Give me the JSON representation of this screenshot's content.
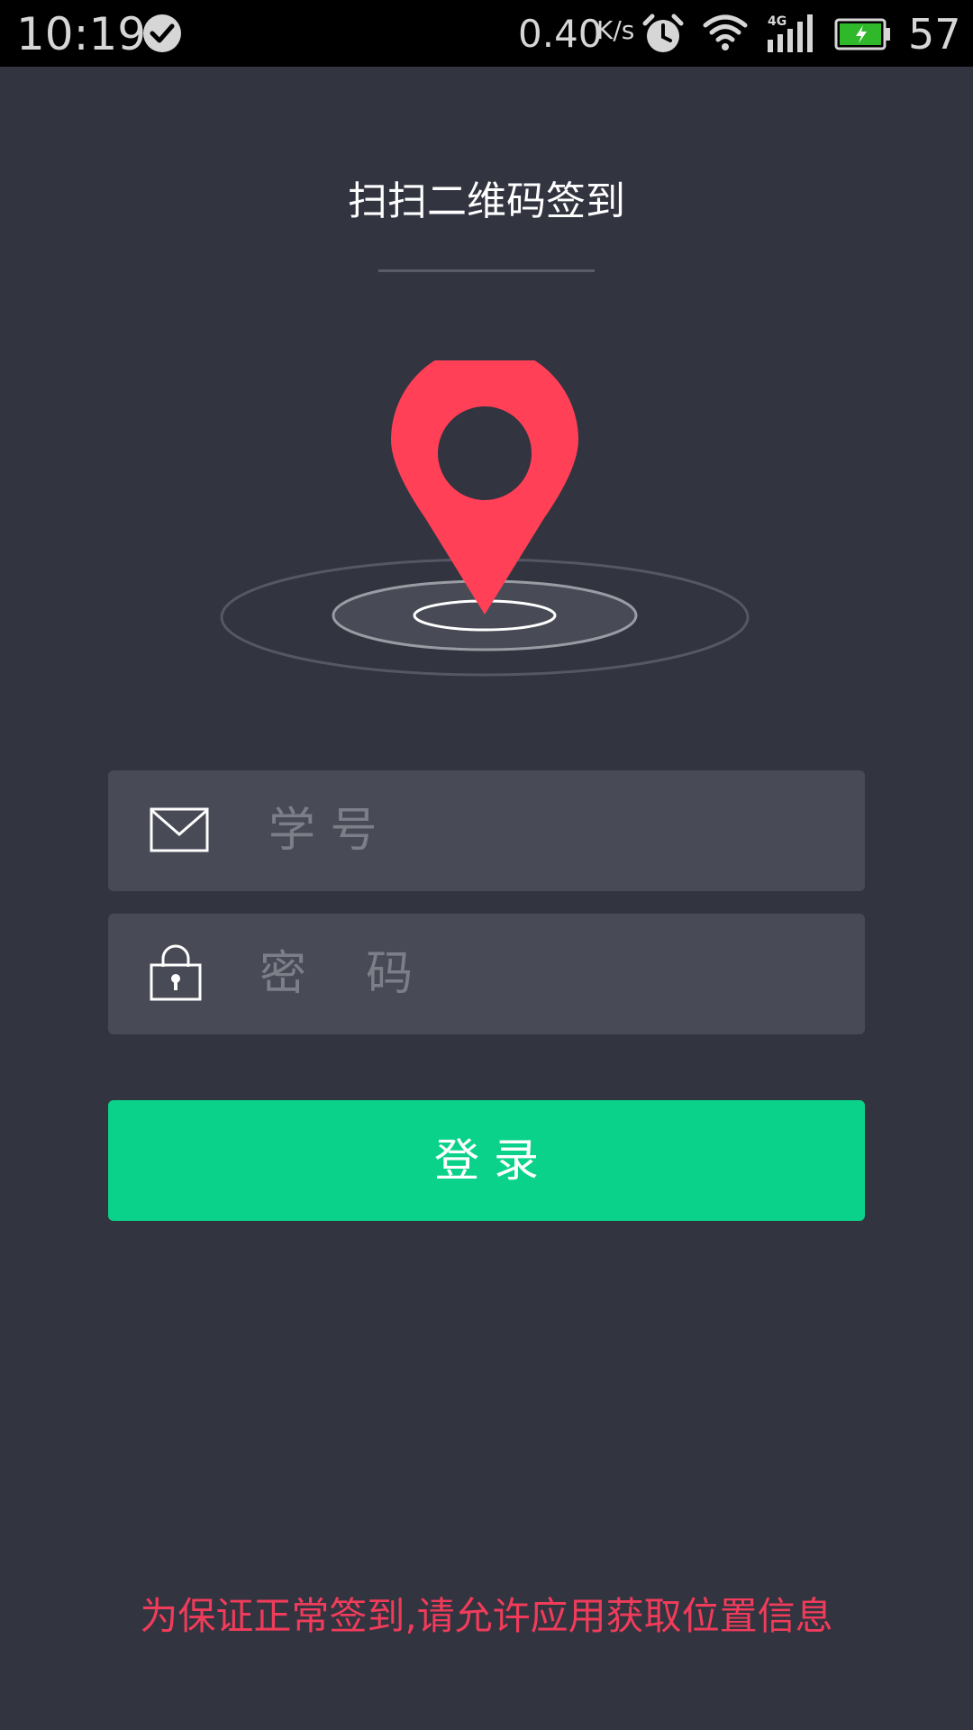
{
  "status_bar": {
    "time": "10:19",
    "network_speed": "0.40",
    "network_speed_unit": "K/s",
    "battery_level": "57",
    "icons": [
      "check-icon",
      "alarm-icon",
      "wifi-icon",
      "signal-4g-icon",
      "battery-charging-icon"
    ]
  },
  "header": {
    "title": "扫扫二维码签到"
  },
  "form": {
    "student_id_placeholder": "学 号",
    "password_placeholder": "密    码",
    "student_id_icon": "mail-icon",
    "password_icon": "lock-icon",
    "login_label": "登 录"
  },
  "footer": {
    "notice": "为保证正常签到,请允许应用获取位置信息"
  },
  "colors": {
    "background": "#323440",
    "input_background": "#484a56",
    "login_button": "#0bd28a",
    "pin": "#ff4057",
    "notice_text": "#f03c5a"
  }
}
